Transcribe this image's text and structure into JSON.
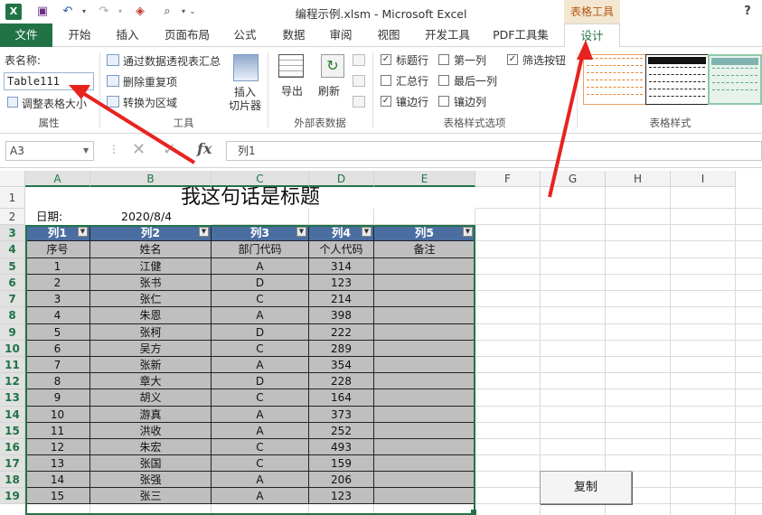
{
  "window": {
    "title": "编程示例.xlsm - Microsoft Excel",
    "context_tab": "表格工具",
    "help": "?"
  },
  "quick_access": {
    "save": "save-icon",
    "undo": "undo-icon",
    "redo": "redo-icon",
    "eraser": "eraser-icon",
    "preview": "print-preview-icon"
  },
  "tabs": [
    "文件",
    "开始",
    "插入",
    "页面布局",
    "公式",
    "数据",
    "审阅",
    "视图",
    "开发工具",
    "PDF工具集",
    "设计"
  ],
  "ribbon": {
    "props": {
      "label_name": "表名称:",
      "table_name": "Table111",
      "resize": "调整表格大小",
      "group": "属性"
    },
    "tools": {
      "pivot": "通过数据透视表汇总",
      "dedupe": "删除重复项",
      "convert": "转换为区域",
      "slicer_1": "插入",
      "slicer_2": "切片器",
      "group": "工具"
    },
    "external": {
      "export": "导出",
      "refresh": "刷新",
      "group": "外部表数据"
    },
    "style_opts": {
      "header_row": "标题行",
      "first_col": "第一列",
      "filter_btn": "筛选按钮",
      "total_row": "汇总行",
      "last_col": "最后一列",
      "banded_rows": "镶边行",
      "banded_cols": "镶边列",
      "group": "表格样式选项",
      "checked": {
        "header_row": true,
        "first_col": false,
        "filter_btn": true,
        "total_row": false,
        "last_col": false,
        "banded_rows": true,
        "banded_cols": false
      }
    },
    "styles": {
      "group": "表格样式"
    }
  },
  "formula_bar": {
    "name_box": "A3",
    "formula": "列1",
    "fx": "fx"
  },
  "columns": [
    "A",
    "B",
    "C",
    "D",
    "E",
    "F",
    "G",
    "H",
    "I"
  ],
  "sheet": {
    "title": "我这句话是标题",
    "date_label": "日期:",
    "date_value": "2020/8/4",
    "table_headers": [
      "列1",
      "列2",
      "列3",
      "列4",
      "列5"
    ],
    "subheaders": [
      "序号",
      "姓名",
      "部门代码",
      "个人代码",
      "备注"
    ],
    "rows": [
      [
        "1",
        "江健",
        "A",
        "314",
        ""
      ],
      [
        "2",
        "张书",
        "D",
        "123",
        ""
      ],
      [
        "3",
        "张仁",
        "C",
        "214",
        ""
      ],
      [
        "4",
        "朱恩",
        "A",
        "398",
        ""
      ],
      [
        "5",
        "张柯",
        "D",
        "222",
        ""
      ],
      [
        "6",
        "吴方",
        "C",
        "289",
        ""
      ],
      [
        "7",
        "张新",
        "A",
        "354",
        ""
      ],
      [
        "8",
        "章大",
        "D",
        "228",
        ""
      ],
      [
        "9",
        "胡义",
        "C",
        "164",
        ""
      ],
      [
        "10",
        "游真",
        "A",
        "373",
        ""
      ],
      [
        "11",
        "洪收",
        "A",
        "252",
        ""
      ],
      [
        "12",
        "朱宏",
        "C",
        "493",
        ""
      ],
      [
        "13",
        "张国",
        "C",
        "159",
        ""
      ],
      [
        "14",
        "张强",
        "A",
        "206",
        ""
      ],
      [
        "15",
        "张三",
        "A",
        "123",
        ""
      ]
    ]
  },
  "copy_button": "复制"
}
